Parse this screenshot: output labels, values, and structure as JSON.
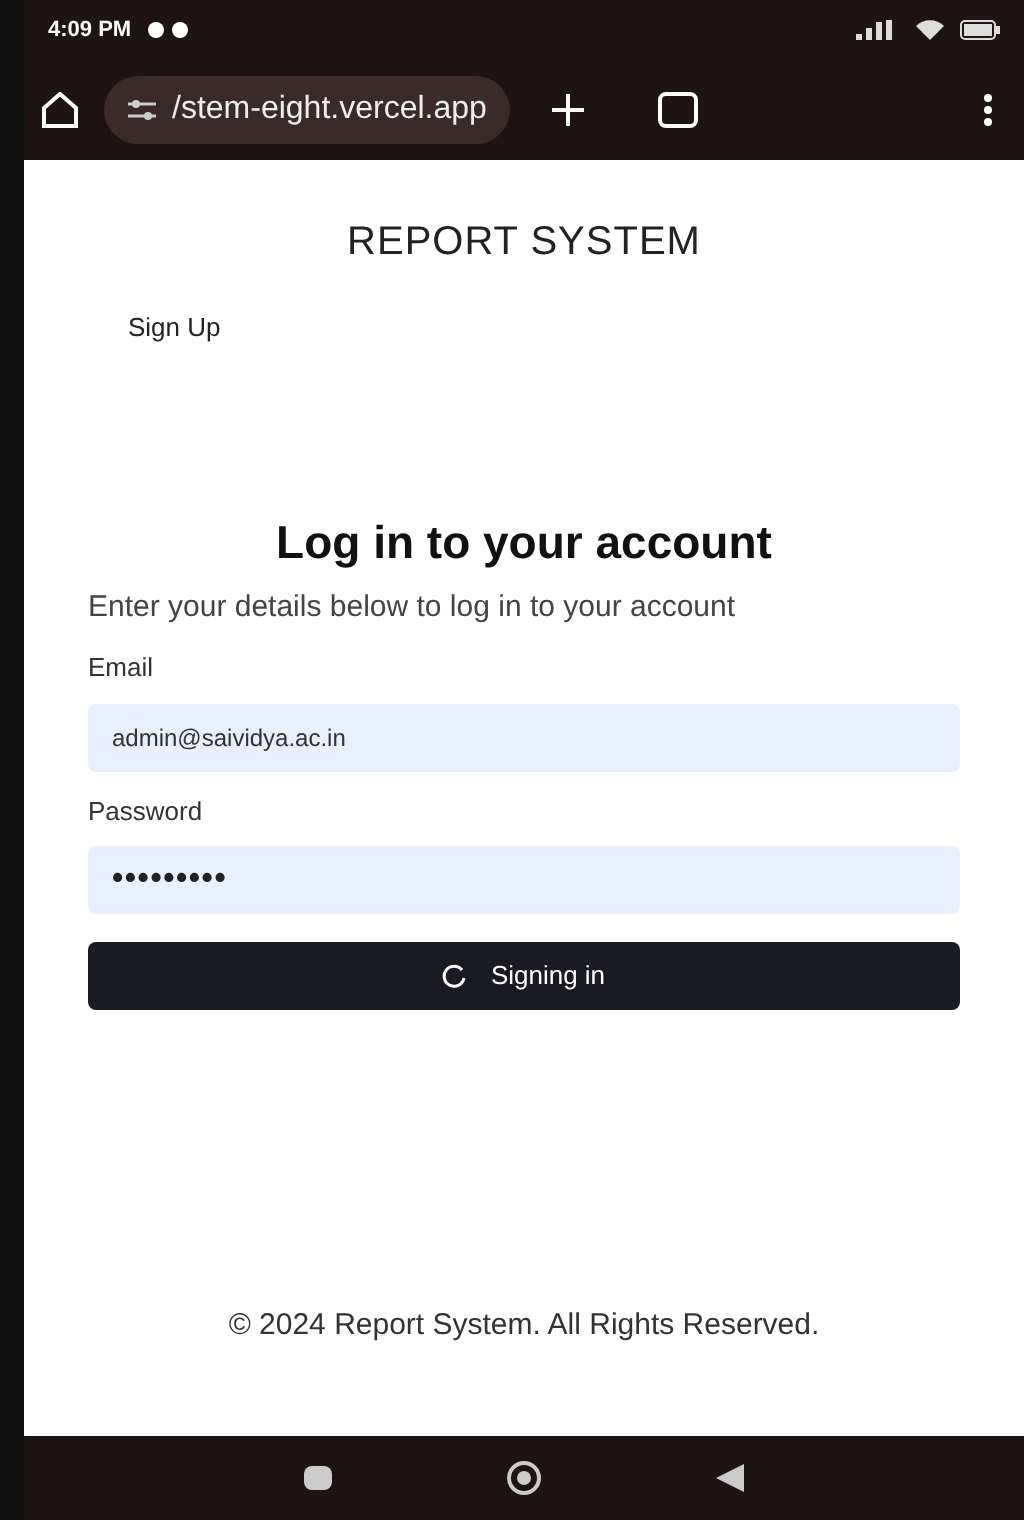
{
  "status_bar": {
    "time": "4:09 PM"
  },
  "browser": {
    "url": "/stem-eight.vercel.app"
  },
  "header": {
    "title": "REPORT SYSTEM",
    "nav_link": "Sign Up"
  },
  "login": {
    "heading": "Log in to your account",
    "subtitle": "Enter your details below to log in to your account",
    "fields": [
      {
        "label": "Email",
        "value": "admin@saividya.ac.in",
        "kind": "text"
      },
      {
        "label": "Password",
        "value": "•••••••••",
        "kind": "password"
      }
    ],
    "button": {
      "label": "Signing in",
      "loading": true
    }
  },
  "footer": "© 2024 Report System. All Rights Reserved."
}
